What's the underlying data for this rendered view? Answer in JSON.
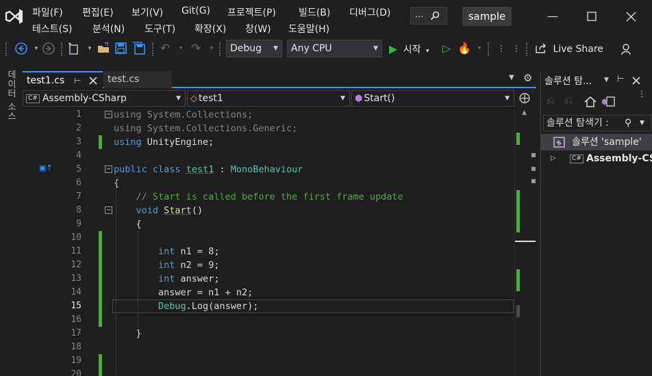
{
  "menu": {
    "row1": [
      "파일(F)",
      "편집(E)",
      "보기(V)",
      "Git(G)",
      "프로젝트(P)",
      "빌드(B)",
      "디버그(D)"
    ],
    "row2": [
      "테스트(S)",
      "분석(N)",
      "도구(T)",
      "확장(X)",
      "창(W)",
      "도움말(H)"
    ],
    "search_dots": "...",
    "project_name": "sample"
  },
  "toolbar": {
    "config": "Debug",
    "platform": "Any CPU",
    "start_label": "시작",
    "live_share": "Live Share"
  },
  "left_strip": {
    "label": "데이터 소스"
  },
  "editor": {
    "tabs": [
      {
        "label": "test1.cs",
        "active": true
      },
      {
        "label": "test.cs",
        "active": false
      }
    ],
    "nav": {
      "project": "Assembly-CSharp",
      "class": "test1",
      "member": "Start()",
      "project_badge": "C#"
    },
    "current_line": 15,
    "lines": [
      {
        "n": "1"
      },
      {
        "n": "2"
      },
      {
        "n": "3"
      },
      {
        "n": "4"
      },
      {
        "n": "5"
      },
      {
        "n": "6"
      },
      {
        "n": "7"
      },
      {
        "n": "8"
      },
      {
        "n": "9"
      },
      {
        "n": "10"
      },
      {
        "n": "11"
      },
      {
        "n": "12"
      },
      {
        "n": "13"
      },
      {
        "n": "14"
      },
      {
        "n": "15"
      },
      {
        "n": "16"
      },
      {
        "n": "17"
      },
      {
        "n": "18"
      },
      {
        "n": "19"
      },
      {
        "n": "20"
      }
    ],
    "code": {
      "l1": "System.Collections;",
      "l2": "System.Collections.Generic;",
      "l3": "UnityEngine;",
      "using": "using",
      "public": "public",
      "class": "class",
      "class_name": "test1",
      "colon": " : ",
      "base": "MonoBehaviour",
      "brace_open": "{",
      "brace_close": "}",
      "comment": "// Start is called before the first frame update",
      "void": "void",
      "method": "Start",
      "parens": "()",
      "int": "int",
      "n1": " n1 = 8;",
      "n2": " n2 = 9;",
      "ans_decl": " answer;",
      "ans_assign": "answer = n1 + n2;",
      "debug": "Debug",
      "log_call": ".Log(answer);"
    }
  },
  "solution": {
    "title": "솔루션 탐...",
    "search_label": "솔루션 탐색기 :",
    "root": "솔루션 'sample'",
    "project": "Assembly-CS",
    "project_badge": "C#"
  }
}
